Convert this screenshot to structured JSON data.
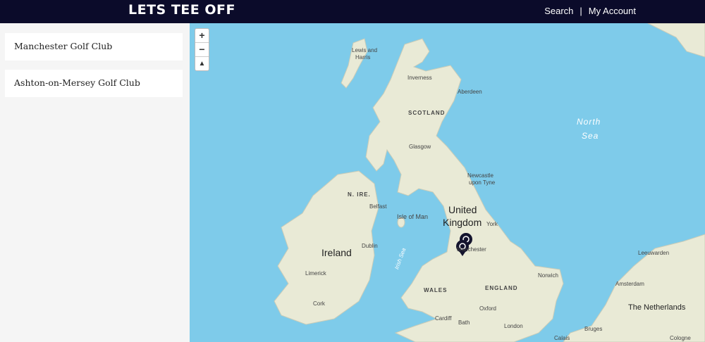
{
  "header": {
    "brand": "LETS TEE OFF",
    "search_label": "Search",
    "separator": "|",
    "account_label": "My Account"
  },
  "clubs": [
    {
      "name": "Manchester Golf Club"
    },
    {
      "name": "Ashton-on-Mersey Golf Club"
    }
  ],
  "map": {
    "zoom_in": "+",
    "zoom_out": "−",
    "reset_north": "▲",
    "labels": {
      "united_kingdom_1": "United",
      "united_kingdom_2": "Kingdom",
      "ireland": "Ireland",
      "scotland": "SCOTLAND",
      "england": "ENGLAND",
      "wales": "WALES",
      "n_ire": "N. IRE.",
      "isle_of_man": "Isle of Man",
      "north_sea_1": "North",
      "north_sea_2": "Sea",
      "irish_sea": "Irish Sea",
      "netherlands": "The Netherlands",
      "lewis_1": "Lewis and",
      "lewis_2": "Harris",
      "inverness": "Inverness",
      "aberdeen": "Aberdeen",
      "glasgow": "Glasgow",
      "newcastle_1": "Newcastle",
      "newcastle_2": "upon Tyne",
      "belfast": "Belfast",
      "york": "York",
      "dublin": "Dublin",
      "manchester": "Manchester",
      "limerick": "Limerick",
      "cork": "Cork",
      "norwich": "Norwich",
      "oxford": "Oxford",
      "london": "London",
      "cardiff": "Cardiff",
      "bath": "Bath",
      "amsterdam": "Amsterdam",
      "leeuwarden": "Leeuwarden",
      "bruges": "Bruges",
      "calais": "Calais",
      "cologne": "Cologne"
    },
    "colors": {
      "water": "#7ecbea",
      "land": "#e9ead6",
      "marker": "#14142e"
    }
  }
}
